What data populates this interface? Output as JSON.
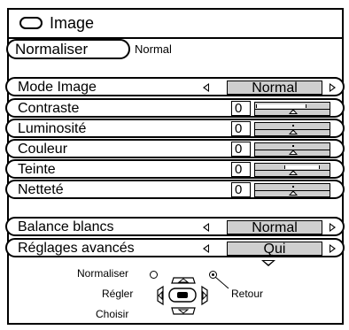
{
  "header": {
    "title": "Image",
    "title_icon": "rounded-rect-icon"
  },
  "normalize": {
    "button_label": "Normaliser",
    "status": "Normal"
  },
  "menu": {
    "mode_image": {
      "label": "Mode Image",
      "value": "Normal"
    },
    "contraste": {
      "label": "Contraste",
      "value": "0",
      "fill_start": 0.0,
      "fill_end": 0.68
    },
    "luminosite": {
      "label": "Luminosité",
      "value": "0"
    },
    "couleur": {
      "label": "Couleur",
      "value": "0"
    },
    "teinte": {
      "label": "Teinte",
      "value": "0",
      "fill_start": 0.4,
      "fill_end": 0.86
    },
    "nettete": {
      "label": "Netteté",
      "value": "0"
    },
    "balance_blancs": {
      "label": "Balance blancs",
      "value": "Normal"
    },
    "reglages_avances": {
      "label": "Réglages avancés",
      "value": "Qui"
    }
  },
  "help": {
    "normaliser": "Normaliser",
    "regler": "Régler",
    "choisir": "Choisir",
    "retour": "Retour"
  },
  "colors": {
    "background": "#ffffff",
    "value_box": "#cfcfcf",
    "outline": "#000000"
  }
}
